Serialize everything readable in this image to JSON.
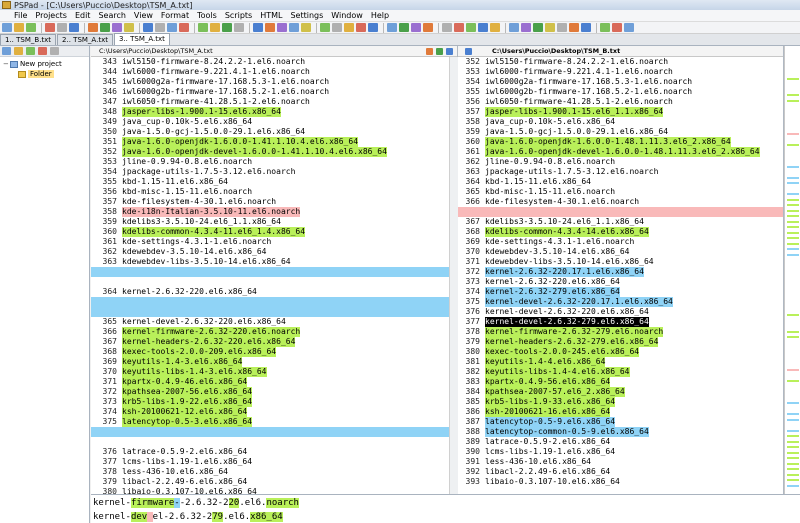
{
  "window": {
    "title": "PSPad - [C:\\Users\\Puccio\\Desktop\\TSM_A.txt]"
  },
  "menu": [
    "File",
    "Projects",
    "Edit",
    "Search",
    "View",
    "Format",
    "Tools",
    "Scripts",
    "HTML",
    "Settings",
    "Window",
    "Help"
  ],
  "tabs": [
    {
      "label": "1.. TSM_B.txt",
      "active": false
    },
    {
      "label": "2.. TSM_A.txt",
      "active": false
    },
    {
      "label": "3.. TSM_A.txt",
      "active": true
    }
  ],
  "project": {
    "root": "New project",
    "folder": "Folder"
  },
  "left_pane": {
    "path": "C:\\Users\\Puccio\\Desktop\\TSM_A.txt",
    "lines": [
      {
        "n": "343",
        "t": "iwl5150-firmware-8.24.2.2-1.el6.noarch",
        "c": ""
      },
      {
        "n": "344",
        "t": "iwl6000-firmware-9.221.4.1-1.el6.noarch",
        "c": ""
      },
      {
        "n": "345",
        "t": "iwl6000g2a-firmware-17.168.5.3-1.el6.noarch",
        "c": ""
      },
      {
        "n": "346",
        "t": "iwl6000g2b-firmware-17.168.5.2-1.el6.noarch",
        "c": ""
      },
      {
        "n": "347",
        "t": "iwl6050-firmware-41.28.5.1-2.el6.noarch",
        "c": ""
      },
      {
        "n": "348",
        "t": "jasper-libs-1.900.1-15.el6.x86_64",
        "c": "g"
      },
      {
        "n": "349",
        "t": "java_cup-0.10k-5.el6.x86_64",
        "c": ""
      },
      {
        "n": "350",
        "t": "java-1.5.0-gcj-1.5.0.0-29.1.el6.x86_64",
        "c": ""
      },
      {
        "n": "351",
        "t": "java-1.6.0-openjdk-1.6.0.0-1.41.1.10.4.el6.x86_64",
        "c": "g"
      },
      {
        "n": "352",
        "t": "java-1.6.0-openjdk-devel-1.6.0.0-1.41.1.10.4.el6.x86_64",
        "c": "g"
      },
      {
        "n": "353",
        "t": "jline-0.9.94-0.8.el6.noarch",
        "c": ""
      },
      {
        "n": "354",
        "t": "jpackage-utils-1.7.5-3.12.el6.noarch",
        "c": ""
      },
      {
        "n": "355",
        "t": "kbd-1.15-11.el6.x86_64",
        "c": ""
      },
      {
        "n": "356",
        "t": "kbd-misc-1.15-11.el6.noarch",
        "c": ""
      },
      {
        "n": "357",
        "t": "kde-filesystem-4-30.1.el6.noarch",
        "c": ""
      },
      {
        "n": "358",
        "t": "kde-i18n-Italian-3.5.10-11.el6.noarch",
        "c": "r"
      },
      {
        "n": "359",
        "t": "kdelibs3-3.5.10-24.el6_1.1.x86_64",
        "c": ""
      },
      {
        "n": "360",
        "t": "kdelibs-common-4.3.4-11.el6_1.4.x86_64",
        "c": "g"
      },
      {
        "n": "361",
        "t": "kde-settings-4.3.1-1.el6.noarch",
        "c": ""
      },
      {
        "n": "362",
        "t": "kdewebdev-3.5.10-14.el6.x86_64",
        "c": ""
      },
      {
        "n": "363",
        "t": "kdewebdev-libs-3.5.10-14.el6.x86_64",
        "c": ""
      },
      {
        "n": "",
        "t": "",
        "c": "gap-b"
      },
      {
        "n": "",
        "t": "",
        "c": "blank"
      },
      {
        "n": "364",
        "t": "kernel-2.6.32-220.el6.x86_64",
        "c": ""
      },
      {
        "n": "",
        "t": "",
        "c": "gap-b"
      },
      {
        "n": "",
        "t": "",
        "c": "gap-b"
      },
      {
        "n": "365",
        "t": "kernel-devel-2.6.32-220.el6.x86_64",
        "c": ""
      },
      {
        "n": "366",
        "t": "kernel-firmware-2.6.32-220.el6.noarch",
        "c": "g"
      },
      {
        "n": "367",
        "t": "kernel-headers-2.6.32-220.el6.x86_64",
        "c": "g"
      },
      {
        "n": "368",
        "t": "kexec-tools-2.0.0-209.el6.x86_64",
        "c": "g"
      },
      {
        "n": "369",
        "t": "keyutils-1.4-3.el6.x86_64",
        "c": "g"
      },
      {
        "n": "370",
        "t": "keyutils-libs-1.4-3.el6.x86_64",
        "c": "g"
      },
      {
        "n": "371",
        "t": "kpartx-0.4.9-46.el6.x86_64",
        "c": "g"
      },
      {
        "n": "372",
        "t": "kpathsea-2007-56.el6.x86_64",
        "c": "g"
      },
      {
        "n": "373",
        "t": "krb5-libs-1.9-22.el6.x86_64",
        "c": "g"
      },
      {
        "n": "374",
        "t": "ksh-20100621-12.el6.x86_64",
        "c": "g"
      },
      {
        "n": "375",
        "t": "latencytop-0.5-3.el6.x86_64",
        "c": "g"
      },
      {
        "n": "",
        "t": "",
        "c": "gap-b"
      },
      {
        "n": "",
        "t": "",
        "c": "blank"
      },
      {
        "n": "376",
        "t": "latrace-0.5.9-2.el6.x86_64",
        "c": ""
      },
      {
        "n": "377",
        "t": "lcms-libs-1.19-1.el6.x86_64",
        "c": ""
      },
      {
        "n": "378",
        "t": "less-436-10.el6.x86_64",
        "c": ""
      },
      {
        "n": "379",
        "t": "libacl-2.2.49-6.el6.x86_64",
        "c": ""
      },
      {
        "n": "380",
        "t": "libaio-0.3.107-10.el6.x86_64",
        "c": ""
      }
    ]
  },
  "right_pane": {
    "path": "C:\\Users\\Puccio\\Desktop\\TSM_B.txt",
    "lines": [
      {
        "n": "352",
        "t": "iwl5150-firmware-8.24.2.2-1.el6.noarch",
        "c": ""
      },
      {
        "n": "353",
        "t": "iwl6000-firmware-9.221.4.1-1.el6.noarch",
        "c": ""
      },
      {
        "n": "354",
        "t": "iwl6000g2a-firmware-17.168.5.3-1.el6.noarch",
        "c": ""
      },
      {
        "n": "355",
        "t": "iwl6000g2b-firmware-17.168.5.2-1.el6.noarch",
        "c": ""
      },
      {
        "n": "356",
        "t": "iwl6050-firmware-41.28.5.1-2.el6.noarch",
        "c": ""
      },
      {
        "n": "357",
        "t": "jasper-libs-1.900.1-15.el6_1.1.x86_64",
        "c": "g"
      },
      {
        "n": "358",
        "t": "java_cup-0.10k-5.el6.x86_64",
        "c": ""
      },
      {
        "n": "359",
        "t": "java-1.5.0-gcj-1.5.0.0-29.1.el6.x86_64",
        "c": ""
      },
      {
        "n": "360",
        "t": "java-1.6.0-openjdk-1.6.0.0-1.48.1.11.3.el6_2.x86_64",
        "c": "g"
      },
      {
        "n": "361",
        "t": "java-1.6.0-openjdk-devel-1.6.0.0-1.48.1.11.3.el6_2.x86_64",
        "c": "g"
      },
      {
        "n": "362",
        "t": "jline-0.9.94-0.8.el6.noarch",
        "c": ""
      },
      {
        "n": "363",
        "t": "jpackage-utils-1.7.5-3.12.el6.noarch",
        "c": ""
      },
      {
        "n": "364",
        "t": "kbd-1.15-11.el6.x86_64",
        "c": ""
      },
      {
        "n": "365",
        "t": "kbd-misc-1.15-11.el6.noarch",
        "c": ""
      },
      {
        "n": "366",
        "t": "kde-filesystem-4-30.1.el6.noarch",
        "c": ""
      },
      {
        "n": "",
        "t": "",
        "c": "gap-r"
      },
      {
        "n": "367",
        "t": "kdelibs3-3.5.10-24.el6_1.1.x86_64",
        "c": ""
      },
      {
        "n": "368",
        "t": "kdelibs-common-4.3.4-14.el6.x86_64",
        "c": "g"
      },
      {
        "n": "369",
        "t": "kde-settings-4.3.1-1.el6.noarch",
        "c": ""
      },
      {
        "n": "370",
        "t": "kdewebdev-3.5.10-14.el6.x86_64",
        "c": ""
      },
      {
        "n": "371",
        "t": "kdewebdev-libs-3.5.10-14.el6.x86_64",
        "c": ""
      },
      {
        "n": "372",
        "t": "kernel-2.6.32-220.17.1.el6.x86_64",
        "c": "b"
      },
      {
        "n": "373",
        "t": "kernel-2.6.32-220.el6.x86_64",
        "c": ""
      },
      {
        "n": "374",
        "t": "kernel-2.6.32-279.el6.x86_64",
        "c": "b"
      },
      {
        "n": "375",
        "t": "kernel-devel-2.6.32-220.17.1.el6.x86_64",
        "c": "b"
      },
      {
        "n": "376",
        "t": "kernel-devel-2.6.32-220.el6.x86_64",
        "c": ""
      },
      {
        "n": "377",
        "t": "kernel-devel-2.6.32-279.el6.x86_64",
        "c": "sel"
      },
      {
        "n": "378",
        "t": "kernel-firmware-2.6.32-279.el6.noarch",
        "c": "g"
      },
      {
        "n": "379",
        "t": "kernel-headers-2.6.32-279.el6.x86_64",
        "c": "g"
      },
      {
        "n": "380",
        "t": "kexec-tools-2.0.0-245.el6.x86_64",
        "c": "g"
      },
      {
        "n": "381",
        "t": "keyutils-1.4-4.el6.x86_64",
        "c": "g"
      },
      {
        "n": "382",
        "t": "keyutils-libs-1.4-4.el6.x86_64",
        "c": "g"
      },
      {
        "n": "383",
        "t": "kpartx-0.4.9-56.el6.x86_64",
        "c": "g"
      },
      {
        "n": "384",
        "t": "kpathsea-2007-57.el6_2.x86_64",
        "c": "g"
      },
      {
        "n": "385",
        "t": "krb5-libs-1.9-33.el6.x86_64",
        "c": "g"
      },
      {
        "n": "386",
        "t": "ksh-20100621-16.el6.x86_64",
        "c": "g"
      },
      {
        "n": "387",
        "t": "latencytop-0.5-9.el6.x86_64",
        "c": "b"
      },
      {
        "n": "388",
        "t": "latencytop-common-0.5-9.el6.x86_64",
        "c": "b"
      },
      {
        "n": "389",
        "t": "latrace-0.5.9-2.el6.x86_64",
        "c": ""
      },
      {
        "n": "390",
        "t": "lcms-libs-1.19-1.el6.x86_64",
        "c": ""
      },
      {
        "n": "391",
        "t": "less-436-10.el6.x86_64",
        "c": ""
      },
      {
        "n": "392",
        "t": "libacl-2.2.49-6.el6.x86_64",
        "c": ""
      },
      {
        "n": "393",
        "t": "libaio-0.3.107-10.el6.x86_64",
        "c": ""
      }
    ]
  },
  "compare_lines": [
    [
      {
        "t": "kernel-",
        "h": ""
      },
      {
        "t": "firmware",
        "h": "g"
      },
      {
        "t": "-",
        "h": "b"
      },
      {
        "t": "-2.6.32-2",
        "h": ""
      },
      {
        "t": "20",
        "h": "g"
      },
      {
        "t": ".el6.",
        "h": ""
      },
      {
        "t": "noarch",
        "h": "g"
      }
    ],
    [
      {
        "t": "kernel-",
        "h": ""
      },
      {
        "t": "dev",
        "h": "g"
      },
      {
        "t": "   ",
        "h": "r"
      },
      {
        "t": "el-2.6.32-2",
        "h": ""
      },
      {
        "t": "79",
        "h": "g"
      },
      {
        "t": ".el6.",
        "h": ""
      },
      {
        "t": "x86_64",
        "h": "g"
      }
    ]
  ],
  "colors": {
    "added": "#b9f05a",
    "changed": "#8fd3f6",
    "removed": "#f9b9b9",
    "selection": "#000000"
  }
}
